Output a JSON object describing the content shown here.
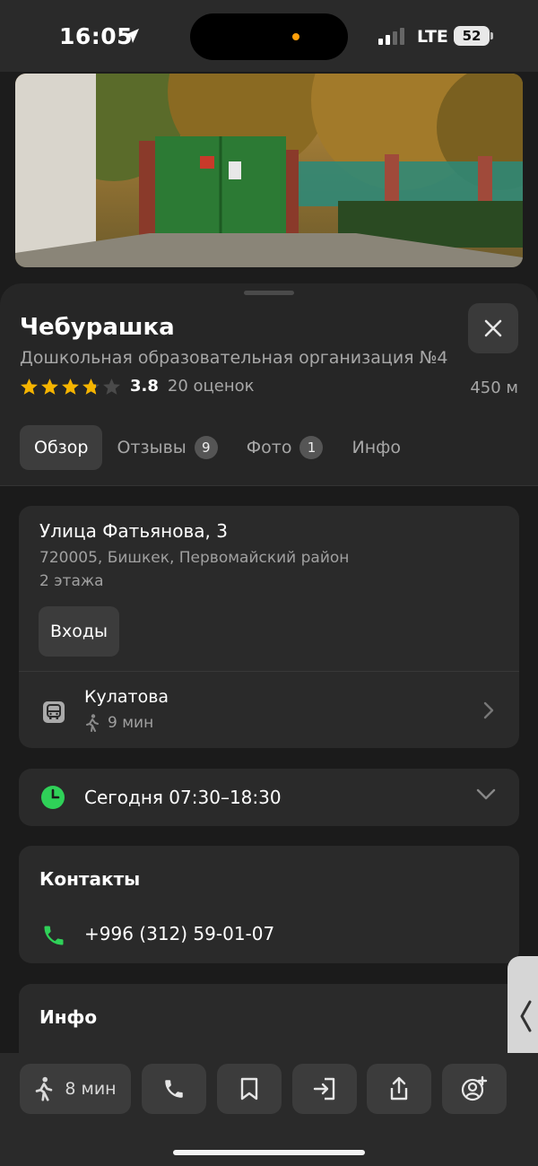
{
  "status_bar": {
    "time": "16:05",
    "network": "LTE",
    "battery": "52"
  },
  "place": {
    "name": "Чебурашка",
    "category": "Дошкольная образовательная организация №4",
    "rating": "3.8",
    "rating_value": 3.8,
    "rating_count": "20 оценок",
    "distance": "450 м"
  },
  "tabs": [
    {
      "label": "Обзор",
      "active": true
    },
    {
      "label": "Отзывы",
      "count": "9"
    },
    {
      "label": "Фото",
      "count": "1"
    },
    {
      "label": "Инфо"
    }
  ],
  "address": {
    "street": "Улица Фатьянова, 3",
    "postal": "720005, Бишкек, Первомайский район",
    "floors": "2 этажа",
    "entrances_button": "Входы"
  },
  "transit": {
    "stop": "Кулатова",
    "walk_time": "9 мин"
  },
  "hours": {
    "text": "Сегодня 07:30–18:30"
  },
  "contacts": {
    "title": "Контакты",
    "phone": "+996 (312) 59-01-07"
  },
  "info": {
    "title": "Инфо"
  },
  "toolbar": {
    "walk_time": "8 мин"
  },
  "colors": {
    "accent_green": "#2fd158",
    "star": "#f5b400",
    "background": "#1c1c1c"
  }
}
